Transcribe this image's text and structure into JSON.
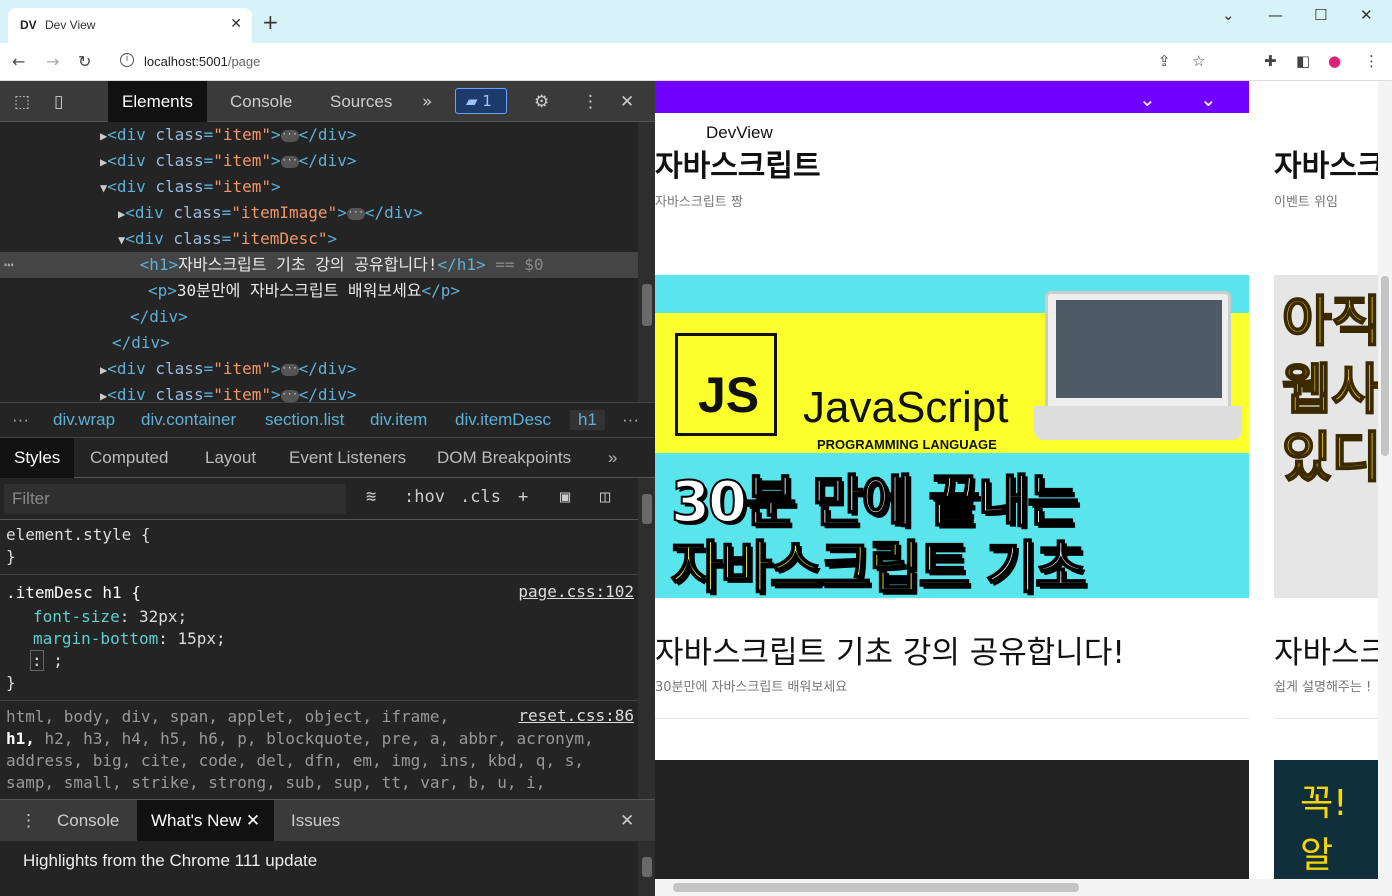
{
  "browser": {
    "tab_favicon": "DV",
    "tab_title": "Dev View",
    "tab_close": "✕",
    "new_tab": "+",
    "url_host": "localhost:5001",
    "url_path": "/page"
  },
  "devtools": {
    "tabs": [
      "Elements",
      "Console",
      "Sources"
    ],
    "issues_count": "1",
    "dom_lines": [
      {
        "indent": 6,
        "arrow": "▶",
        "cls": "item",
        "collapsed": true
      },
      {
        "indent": 6,
        "arrow": "▶",
        "cls": "item",
        "collapsed": true
      },
      {
        "indent": 6,
        "arrow": "▼",
        "cls": "item",
        "collapsed": false
      },
      {
        "indent": 7,
        "arrow": "▶",
        "cls": "itemImage",
        "collapsed": true
      },
      {
        "indent": 7,
        "arrow": "▼",
        "cls": "itemDesc",
        "collapsed": false
      }
    ],
    "h1_text": "자바스크립트 기초 강의 공유합니다!",
    "selected_marker": "== $0",
    "p_text": "30분만에 자바스크립트 배워보세요",
    "breadcrumbs": [
      "div.wrap",
      "div.container",
      "section.list",
      "div.item",
      "div.itemDesc",
      "h1"
    ],
    "style_tabs": [
      "Styles",
      "Computed",
      "Layout",
      "Event Listeners",
      "DOM Breakpoints"
    ],
    "filter_placeholder": "Filter",
    "hov": ":hov",
    "cls": ".cls",
    "element_style": "element.style {",
    "rule_selector": ".itemDesc h1 {",
    "rule_source": "page.css:102",
    "decl1_prop": "font-size",
    "decl1_val": " 32px;",
    "decl2_prop": "margin-bottom",
    "decl2_val": " 15px;",
    "reset_source": "reset.css:86",
    "reset_line1": "html, body, div, span, applet, object, iframe,",
    "reset_line2": "h2, h3, h4, h5, h6, p, blockquote, pre, a, abbr, acronym,",
    "reset_line3": "address, big, cite, code, del, dfn, em, img, ins, kbd, q, s,",
    "reset_line4": "samp, small, strike, strong, sub, sup, tt, var, b, u, i,",
    "drawer_tabs": [
      "Console",
      "What's New",
      "Issues"
    ],
    "drawer_text": "Highlights from the Chrome 111 update"
  },
  "page": {
    "logo": "DevView",
    "card1_title": "자바스크립트",
    "card1_sub": "자바스크립트 짱",
    "card2_title": "자바스크",
    "card2_sub": "이벤트 위임",
    "thumb_js": "JS",
    "thumb_name": "JavaScript",
    "thumb_prog": "PROGRAMMING LANGUAGE",
    "thumb_line1": "30분 만에 끝내는",
    "thumb_line2a": "자바스크립트",
    "thumb_line2b": " 기초",
    "thumb2_lines": [
      "아직",
      "웹사",
      "있디"
    ],
    "item_title": "자바스크립트 기초 강의 공유합니다!",
    "item_sub": "30분만에 자바스크립트 배워보세요",
    "item2_title": "자바스크",
    "item2_sub": "쉽게 설명해주는 !",
    "thumb4_text": "꼭! 알"
  }
}
